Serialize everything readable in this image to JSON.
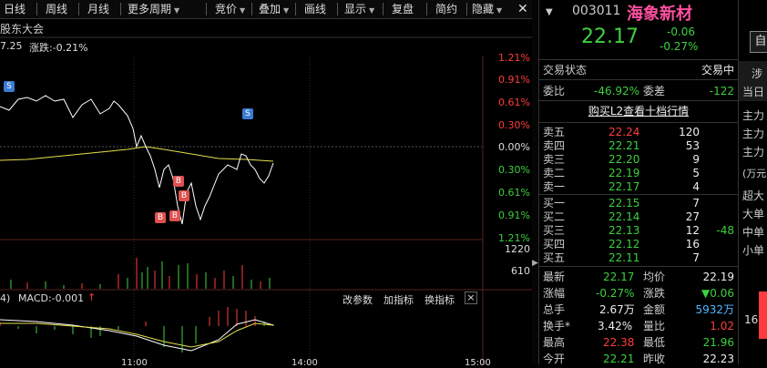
{
  "toolbar": {
    "items": [
      {
        "label": "日线",
        "arrow": false
      },
      {
        "label": "周线",
        "arrow": false
      },
      {
        "label": "月线",
        "arrow": false
      },
      {
        "label": "更多周期",
        "arrow": true
      },
      {
        "label": "竞价",
        "arrow": true
      },
      {
        "label": "叠加",
        "arrow": true
      },
      {
        "label": "画线",
        "arrow": false
      },
      {
        "label": "显示",
        "arrow": true
      },
      {
        "label": "复盘",
        "arrow": false
      },
      {
        "label": "简约",
        "arrow": false
      },
      {
        "label": "隐藏",
        "arrow": true
      }
    ]
  },
  "chart": {
    "title": "股东大会",
    "price_fragment": "7.25",
    "change_label": "涨跌:-0.21%",
    "pct_labels": [
      "1.21%",
      "0.91%",
      "0.61%",
      "0.30%",
      "0.00%",
      "0.30%",
      "0.61%",
      "0.91%",
      "1.21%"
    ],
    "vol_labels": [
      "1220",
      "610"
    ],
    "macd_prefix": "4)",
    "macd_label": "MACD:-0.001",
    "macd_arrow": "↑",
    "macd_buttons": [
      "改参数",
      "加指标",
      "换指标"
    ],
    "close_symbol": "×",
    "time_labels": [
      "11:00",
      "14:00",
      "15:00"
    ],
    "s_marker": "S",
    "b_marker": "B",
    "colors": {
      "up": "#ff3c3c",
      "down": "#3fcf3f",
      "price_line": "#ffffff",
      "avg_line": "#e6e04a",
      "marker_blue": "#3a7bd5",
      "marker_red": "#e05050"
    }
  },
  "quote": {
    "code": "003011",
    "name": "海象新材",
    "price": "22.17",
    "change": "-0.06",
    "change_pct": "-0.27%",
    "status_label": "交易状态",
    "status_value": "交易中",
    "weibi_label": "委比",
    "weibi_value": "-46.92%",
    "weicha_label": "委差",
    "weicha_value": "-122",
    "l2_link": "购买L2查看十档行情",
    "asks": [
      {
        "label": "卖五",
        "price": "22.24",
        "vol": "120",
        "extra": ""
      },
      {
        "label": "卖四",
        "price": "22.21",
        "vol": "53",
        "extra": ""
      },
      {
        "label": "卖三",
        "price": "22.20",
        "vol": "9",
        "extra": ""
      },
      {
        "label": "卖二",
        "price": "22.19",
        "vol": "5",
        "extra": ""
      },
      {
        "label": "卖一",
        "price": "22.17",
        "vol": "4",
        "extra": ""
      }
    ],
    "bids": [
      {
        "label": "买一",
        "price": "22.15",
        "vol": "7",
        "extra": ""
      },
      {
        "label": "买二",
        "price": "22.14",
        "vol": "27",
        "extra": ""
      },
      {
        "label": "买三",
        "price": "22.13",
        "vol": "12",
        "extra": "-48"
      },
      {
        "label": "买四",
        "price": "22.12",
        "vol": "16",
        "extra": ""
      },
      {
        "label": "买五",
        "price": "22.11",
        "vol": "7",
        "extra": ""
      }
    ],
    "stats": [
      {
        "l1": "最新",
        "v1": "22.17",
        "l2": "均价",
        "v2": "22.19"
      },
      {
        "l1": "涨幅",
        "v1": "-0.27%",
        "l2": "涨跌",
        "v2": "▼0.06"
      },
      {
        "l1": "总手",
        "v1": "2.67万",
        "l2": "金额",
        "v2": "5932万"
      },
      {
        "l1": "换手*",
        "v1": "3.42%",
        "l2": "量比",
        "v2": "1.02"
      },
      {
        "l1": "最高",
        "v1": "22.38",
        "l2": "最低",
        "v2": "21.96"
      },
      {
        "l1": "今开",
        "v1": "22.21",
        "l2": "昨收",
        "v2": "22.23"
      }
    ]
  },
  "far_right": {
    "button_label": "自",
    "labels": [
      "涉",
      "当日",
      "主力",
      "主力",
      "主力",
      "(万元",
      "超大",
      "大单",
      "中单",
      "小单"
    ],
    "bottom_value": "16"
  }
}
